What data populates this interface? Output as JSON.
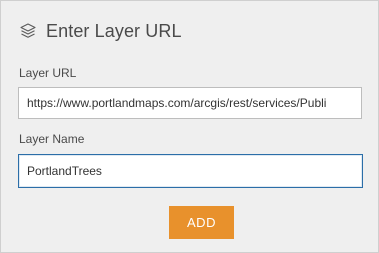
{
  "header": {
    "icon": "layers-icon",
    "title": "Enter Layer URL"
  },
  "form": {
    "url_label": "Layer URL",
    "url_value": "https://www.portlandmaps.com/arcgis/rest/services/Publi",
    "name_label": "Layer Name",
    "name_value": "PortlandTrees"
  },
  "actions": {
    "add_label": "ADD"
  },
  "colors": {
    "accent": "#e8912c",
    "focus_border": "#2b6ea8",
    "panel_background": "#efefef"
  }
}
